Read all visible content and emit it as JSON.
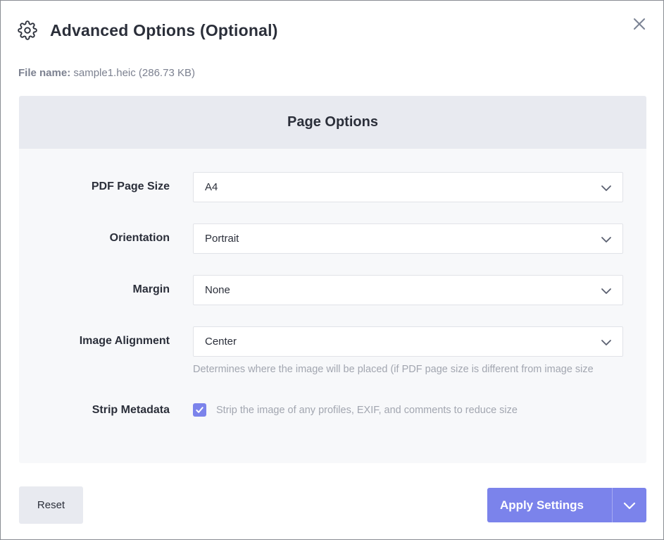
{
  "dialog": {
    "title": "Advanced Options (Optional)",
    "icon": "gear-icon",
    "close_icon": "close-icon"
  },
  "file": {
    "label": "File name:",
    "value": "sample1.heic (286.73 KB)"
  },
  "panel": {
    "title": "Page Options",
    "fields": [
      {
        "label": "PDF Page Size",
        "value": "A4"
      },
      {
        "label": "Orientation",
        "value": "Portrait"
      },
      {
        "label": "Margin",
        "value": "None"
      },
      {
        "label": "Image Alignment",
        "value": "Center",
        "hint": "Determines where the image will be placed (if PDF page size is different from image size"
      }
    ],
    "strip_metadata": {
      "label": "Strip Metadata",
      "checked": true,
      "text": "Strip the image of any profiles, EXIF, and comments to reduce size"
    }
  },
  "footer": {
    "reset_label": "Reset",
    "apply_label": "Apply Settings"
  },
  "colors": {
    "accent": "#7b83eb",
    "panel_header_bg": "#e8eaf0",
    "panel_bg": "#f7f8fa",
    "muted_text": "#a2a6b0"
  }
}
